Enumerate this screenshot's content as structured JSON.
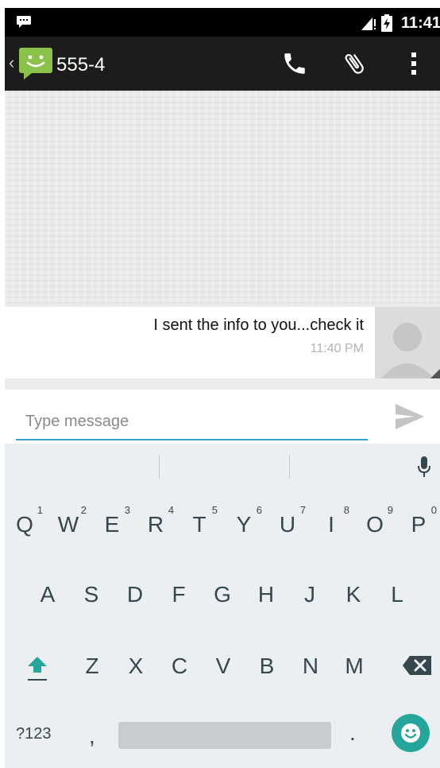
{
  "status_bar": {
    "time": "11:41",
    "icons": [
      "message-notification-icon",
      "signal-icon",
      "battery-charging-icon"
    ]
  },
  "action_bar": {
    "contact_name": "555-4",
    "icons": [
      "back-chevron-icon",
      "messaging-app-icon",
      "phone-icon",
      "paperclip-icon",
      "overflow-menu-icon"
    ]
  },
  "conversation": {
    "messages": [
      {
        "text": "I sent the info to you...check it",
        "time": "11:40 PM",
        "direction": "incoming"
      }
    ]
  },
  "compose": {
    "placeholder": "Type message",
    "value": ""
  },
  "keyboard": {
    "row1": [
      {
        "key": "Q",
        "hint": "1"
      },
      {
        "key": "W",
        "hint": "2"
      },
      {
        "key": "E",
        "hint": "3"
      },
      {
        "key": "R",
        "hint": "4"
      },
      {
        "key": "T",
        "hint": "5"
      },
      {
        "key": "Y",
        "hint": "6"
      },
      {
        "key": "U",
        "hint": "7"
      },
      {
        "key": "I",
        "hint": "8"
      },
      {
        "key": "O",
        "hint": "9"
      },
      {
        "key": "P",
        "hint": "0"
      }
    ],
    "row2": [
      "A",
      "S",
      "D",
      "F",
      "G",
      "H",
      "J",
      "K",
      "L"
    ],
    "row3": [
      "Z",
      "X",
      "C",
      "V",
      "B",
      "N",
      "M"
    ],
    "symbols_label": "?123",
    "comma": ",",
    "period": ".",
    "accent_color": "#26a69a"
  },
  "colors": {
    "status_bar": "#000000",
    "action_bar": "#1c1c1c",
    "conversation_bg": "#ececec",
    "input_underline": "#33a3cc",
    "keyboard_bg": "#eceff1"
  }
}
